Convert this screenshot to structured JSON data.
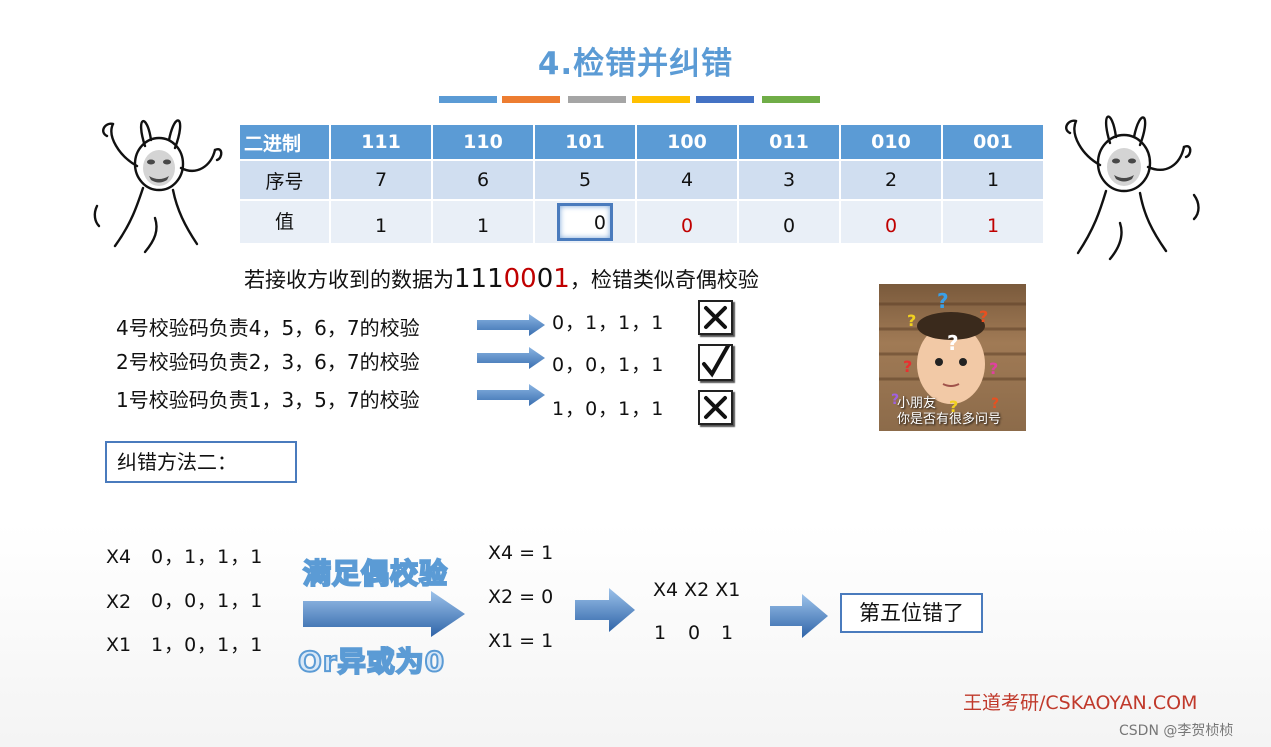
{
  "title": "4.检错并纠错",
  "color_bars": [
    "#5b9bd5",
    "#ed7d31",
    "#a5a5a5",
    "#ffc000",
    "#4472c4",
    "#70ad47"
  ],
  "table": {
    "header_label": "二进制",
    "headers": [
      "111",
      "110",
      "101",
      "100",
      "011",
      "010",
      "001"
    ],
    "seq_label": "序号",
    "seq": [
      "7",
      "6",
      "5",
      "4",
      "3",
      "2",
      "1"
    ],
    "val_label": "值",
    "values": [
      "1",
      "1",
      "0",
      "0",
      "0",
      "0",
      "1"
    ]
  },
  "received": {
    "prefix": "若接收方收到的数据为",
    "bits_black": "111",
    "bits_red1": "00",
    "bits_black2": "0",
    "bits_red2": "1",
    "suffix": "，检错类似奇偶校验"
  },
  "checks": [
    {
      "label": "4号校验码负责4，5，6，7的校验",
      "values": "0，1，1，1",
      "result": "cross"
    },
    {
      "label": "2号校验码负责2，3，6，7的校验",
      "values": "0，0，1，1",
      "result": "check"
    },
    {
      "label": "1号校验码负责1，3，5，7的校验",
      "values": "1，0，1，1",
      "result": "cross"
    }
  ],
  "photo_caption": [
    "小朋友",
    "你是否有很多问号"
  ],
  "method2_label": "纠错方法二：",
  "method2": {
    "rows": [
      {
        "name": "X4",
        "values": "0，1，1，1"
      },
      {
        "name": "X2",
        "values": "0，0，1，1"
      },
      {
        "name": "X1",
        "values": "1，0，1，1"
      }
    ],
    "arrow_top_text": "满足偶校验",
    "arrow_bottom_text": "Or异或为0",
    "results": [
      "X4 = 1",
      "X2 = 0",
      "X1 = 1"
    ],
    "combined_header": "X4 X2 X1",
    "combined_values": [
      "1",
      "0",
      "1"
    ],
    "conclusion": "第五位错了"
  },
  "footer": "王道考研/CSKAOYAN.COM",
  "watermark": "CSDN @李贺桢桢"
}
